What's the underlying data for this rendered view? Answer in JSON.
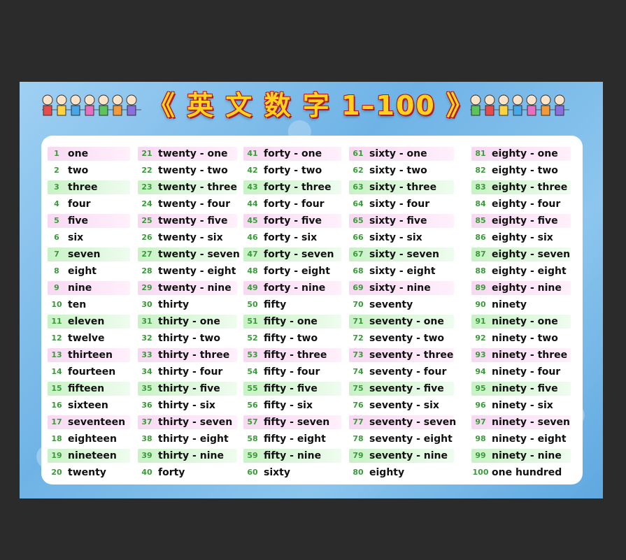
{
  "title": "《 英 文 数 字 1–100 》",
  "colors": {
    "title_fill": "#ffd21e",
    "title_outline": "#b4161b",
    "number": "#3a9a3a",
    "pink_band": "#f7d9f2",
    "green_band": "#c9f2c6",
    "frame": "#7fbde9"
  },
  "icons": [
    "cartoon-kids-left-icon",
    "cartoon-kids-right-icon"
  ],
  "columns": [
    {
      "rows": [
        {
          "num": "1",
          "word": "one"
        },
        {
          "num": "2",
          "word": "two"
        },
        {
          "num": "3",
          "word": "three"
        },
        {
          "num": "4",
          "word": "four"
        },
        {
          "num": "5",
          "word": "five"
        },
        {
          "num": "6",
          "word": "six"
        },
        {
          "num": "7",
          "word": "seven"
        },
        {
          "num": "8",
          "word": "eight"
        },
        {
          "num": "9",
          "word": "nine"
        },
        {
          "num": "10",
          "word": "ten"
        },
        {
          "num": "11",
          "word": "eleven"
        },
        {
          "num": "12",
          "word": "twelve"
        },
        {
          "num": "13",
          "word": "thirteen"
        },
        {
          "num": "14",
          "word": "fourteen"
        },
        {
          "num": "15",
          "word": "fifteen"
        },
        {
          "num": "16",
          "word": "sixteen"
        },
        {
          "num": "17",
          "word": "seventeen"
        },
        {
          "num": "18",
          "word": "eighteen"
        },
        {
          "num": "19",
          "word": "nineteen"
        },
        {
          "num": "20",
          "word": "twenty"
        }
      ]
    },
    {
      "rows": [
        {
          "num": "21",
          "word": "twenty - one"
        },
        {
          "num": "22",
          "word": "twenty - two"
        },
        {
          "num": "23",
          "word": "twenty - three"
        },
        {
          "num": "24",
          "word": "twenty - four"
        },
        {
          "num": "25",
          "word": "twenty - five"
        },
        {
          "num": "26",
          "word": "twenty - six"
        },
        {
          "num": "27",
          "word": "twenty - seven"
        },
        {
          "num": "28",
          "word": "twenty - eight"
        },
        {
          "num": "29",
          "word": "twenty - nine"
        },
        {
          "num": "30",
          "word": "thirty"
        },
        {
          "num": "31",
          "word": "thirty - one"
        },
        {
          "num": "32",
          "word": "thirty - two"
        },
        {
          "num": "33",
          "word": "thirty - three"
        },
        {
          "num": "34",
          "word": "thirty - four"
        },
        {
          "num": "35",
          "word": "thirty - five"
        },
        {
          "num": "36",
          "word": "thirty - six"
        },
        {
          "num": "37",
          "word": "thirty - seven"
        },
        {
          "num": "38",
          "word": "thirty - eight"
        },
        {
          "num": "39",
          "word": "thirty - nine"
        },
        {
          "num": "40",
          "word": "forty"
        }
      ]
    },
    {
      "rows": [
        {
          "num": "41",
          "word": "forty - one"
        },
        {
          "num": "42",
          "word": "forty - two"
        },
        {
          "num": "43",
          "word": "forty - three"
        },
        {
          "num": "44",
          "word": "forty - four"
        },
        {
          "num": "45",
          "word": "forty - five"
        },
        {
          "num": "46",
          "word": "forty - six"
        },
        {
          "num": "47",
          "word": "forty - seven"
        },
        {
          "num": "48",
          "word": "forty - eight"
        },
        {
          "num": "49",
          "word": "forty - nine"
        },
        {
          "num": "50",
          "word": "fifty"
        },
        {
          "num": "51",
          "word": "fifty - one"
        },
        {
          "num": "52",
          "word": "fifty - two"
        },
        {
          "num": "53",
          "word": "fifty - three"
        },
        {
          "num": "54",
          "word": "fifty - four"
        },
        {
          "num": "55",
          "word": "fifty - five"
        },
        {
          "num": "56",
          "word": "fifty - six"
        },
        {
          "num": "57",
          "word": "fifty - seven"
        },
        {
          "num": "58",
          "word": "fifty - eight"
        },
        {
          "num": "59",
          "word": "fifty - nine"
        },
        {
          "num": "60",
          "word": "sixty"
        }
      ]
    },
    {
      "rows": [
        {
          "num": "61",
          "word": "sixty - one"
        },
        {
          "num": "62",
          "word": "sixty - two"
        },
        {
          "num": "63",
          "word": "sixty - three"
        },
        {
          "num": "64",
          "word": "sixty - four"
        },
        {
          "num": "65",
          "word": "sixty - five"
        },
        {
          "num": "66",
          "word": "sixty - six"
        },
        {
          "num": "67",
          "word": "sixty - seven"
        },
        {
          "num": "68",
          "word": "sixty - eight"
        },
        {
          "num": "69",
          "word": "sixty - nine"
        },
        {
          "num": "70",
          "word": "seventy"
        },
        {
          "num": "71",
          "word": "seventy - one"
        },
        {
          "num": "72",
          "word": "seventy - two"
        },
        {
          "num": "73",
          "word": "seventy - three"
        },
        {
          "num": "74",
          "word": "seventy - four"
        },
        {
          "num": "75",
          "word": "seventy - five"
        },
        {
          "num": "76",
          "word": "seventy - six"
        },
        {
          "num": "77",
          "word": "seventy - seven"
        },
        {
          "num": "78",
          "word": "seventy - eight"
        },
        {
          "num": "79",
          "word": "seventy - nine"
        },
        {
          "num": "80",
          "word": "eighty"
        }
      ]
    },
    {
      "rows": [
        {
          "num": "81",
          "word": "eighty - one"
        },
        {
          "num": "82",
          "word": "eighty - two"
        },
        {
          "num": "83",
          "word": "eighty - three"
        },
        {
          "num": "84",
          "word": "eighty - four"
        },
        {
          "num": "85",
          "word": "eighty - five"
        },
        {
          "num": "86",
          "word": "eighty - six"
        },
        {
          "num": "87",
          "word": "eighty - seven"
        },
        {
          "num": "88",
          "word": "eighty - eight"
        },
        {
          "num": "89",
          "word": "eighty - nine"
        },
        {
          "num": "90",
          "word": "ninety"
        },
        {
          "num": "91",
          "word": "ninety - one"
        },
        {
          "num": "92",
          "word": "ninety - two"
        },
        {
          "num": "93",
          "word": "ninety - three"
        },
        {
          "num": "94",
          "word": "ninety - four"
        },
        {
          "num": "95",
          "word": "ninety - five"
        },
        {
          "num": "96",
          "word": "ninety - six"
        },
        {
          "num": "97",
          "word": "ninety - seven"
        },
        {
          "num": "98",
          "word": "ninety - eight"
        },
        {
          "num": "99",
          "word": "ninety - nine"
        },
        {
          "num": "100",
          "word": "one  hundred"
        }
      ]
    }
  ]
}
